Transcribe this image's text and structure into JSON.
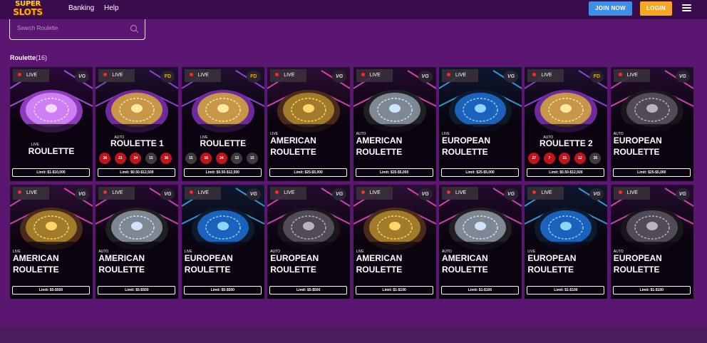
{
  "header": {
    "logo_line1": "SUPER",
    "logo_line2": "SLOTS",
    "nav": [
      "Banking",
      "Help"
    ],
    "join_label": "JOIN NOW",
    "login_label": "LOGIN"
  },
  "search": {
    "placeholder": "Search Roulette"
  },
  "section": {
    "title": "Roulette",
    "count": "(16)"
  },
  "games": [
    {
      "badge": "LIVE",
      "provider": "VG",
      "type": "Live",
      "title": "ROULETTE",
      "limit": "Limit: $1-$10,000",
      "theme": "purple",
      "layout": "center"
    },
    {
      "badge": "LIVE",
      "provider": "FD",
      "type": "Auto",
      "title": "ROULETTE 1",
      "limit": "Limit: $0.50-$12,500",
      "theme": "gold",
      "layout": "center",
      "results": [
        {
          "n": "36",
          "c": "red"
        },
        {
          "n": "21",
          "c": "red"
        },
        {
          "n": "34",
          "c": "red"
        },
        {
          "n": "15",
          "c": "black"
        },
        {
          "n": "36",
          "c": "red"
        }
      ]
    },
    {
      "badge": "LIVE",
      "provider": "FD",
      "type": "Live",
      "title": "ROULETTE",
      "limit": "Limit: $0.50-$12,500",
      "theme": "gold",
      "layout": "center",
      "results": [
        {
          "n": "15",
          "c": "black"
        },
        {
          "n": "16",
          "c": "red"
        },
        {
          "n": "34",
          "c": "red"
        },
        {
          "n": "13",
          "c": "black"
        },
        {
          "n": "15",
          "c": "black"
        }
      ]
    },
    {
      "badge": "LIVE",
      "provider": "VG",
      "type": "Live",
      "title": "AMERICAN ROULETTE",
      "limit": "Limit: $25-$5,000",
      "theme": "brass",
      "layout": "left"
    },
    {
      "badge": "LIVE",
      "provider": "VG",
      "type": "Auto",
      "title": "AMERICAN ROULETTE",
      "limit": "Limit: $25-$5,000",
      "theme": "steel",
      "layout": "left"
    },
    {
      "badge": "LIVE",
      "provider": "VG",
      "type": "Live",
      "title": "EUROPEAN ROULETTE",
      "limit": "Limit: $25-$5,000",
      "theme": "blue",
      "layout": "left"
    },
    {
      "badge": "LIVE",
      "provider": "FD",
      "type": "Auto",
      "title": "ROULETTE 2",
      "limit": "Limit: $0.50-$12,500",
      "theme": "gold",
      "layout": "center",
      "results": [
        {
          "n": "27",
          "c": "red"
        },
        {
          "n": "7",
          "c": "red"
        },
        {
          "n": "21",
          "c": "red"
        },
        {
          "n": "12",
          "c": "red"
        },
        {
          "n": "35",
          "c": "black"
        }
      ]
    },
    {
      "badge": "LIVE",
      "provider": "VG",
      "type": "Auto",
      "title": "EUROPEAN ROULETTE",
      "limit": "Limit: $25-$5,000",
      "theme": "dark",
      "layout": "left"
    },
    {
      "badge": "LIVE",
      "provider": "VG",
      "type": "Live",
      "title": "AMERICAN ROULETTE",
      "limit": "Limit: $5-$500",
      "theme": "brass",
      "layout": "left"
    },
    {
      "badge": "LIVE",
      "provider": "VG",
      "type": "Auto",
      "title": "AMERICAN ROULETTE",
      "limit": "Limit: $5-$500",
      "theme": "steel",
      "layout": "left"
    },
    {
      "badge": "LIVE",
      "provider": "VG",
      "type": "Live",
      "title": "EUROPEAN ROULETTE",
      "limit": "Limit: $5-$500",
      "theme": "blue",
      "layout": "left"
    },
    {
      "badge": "LIVE",
      "provider": "VG",
      "type": "Auto",
      "title": "EUROPEAN ROULETTE",
      "limit": "Limit: $5-$500",
      "theme": "dark",
      "layout": "left"
    },
    {
      "badge": "LIVE",
      "provider": "VG",
      "type": "Live",
      "title": "AMERICAN ROULETTE",
      "limit": "Limit: $1-$100",
      "theme": "brass",
      "layout": "left"
    },
    {
      "badge": "LIVE",
      "provider": "VG",
      "type": "Auto",
      "title": "AMERICAN ROULETTE",
      "limit": "Limit: $1-$100",
      "theme": "steel",
      "layout": "left"
    },
    {
      "badge": "LIVE",
      "provider": "VG",
      "type": "Live",
      "title": "EUROPEAN ROULETTE",
      "limit": "Limit: $1-$100",
      "theme": "blue",
      "layout": "left"
    },
    {
      "badge": "LIVE",
      "provider": "VG",
      "type": "Auto",
      "title": "EUROPEAN ROULETTE",
      "limit": "Limit: $1-$100",
      "theme": "dark",
      "layout": "left"
    }
  ]
}
